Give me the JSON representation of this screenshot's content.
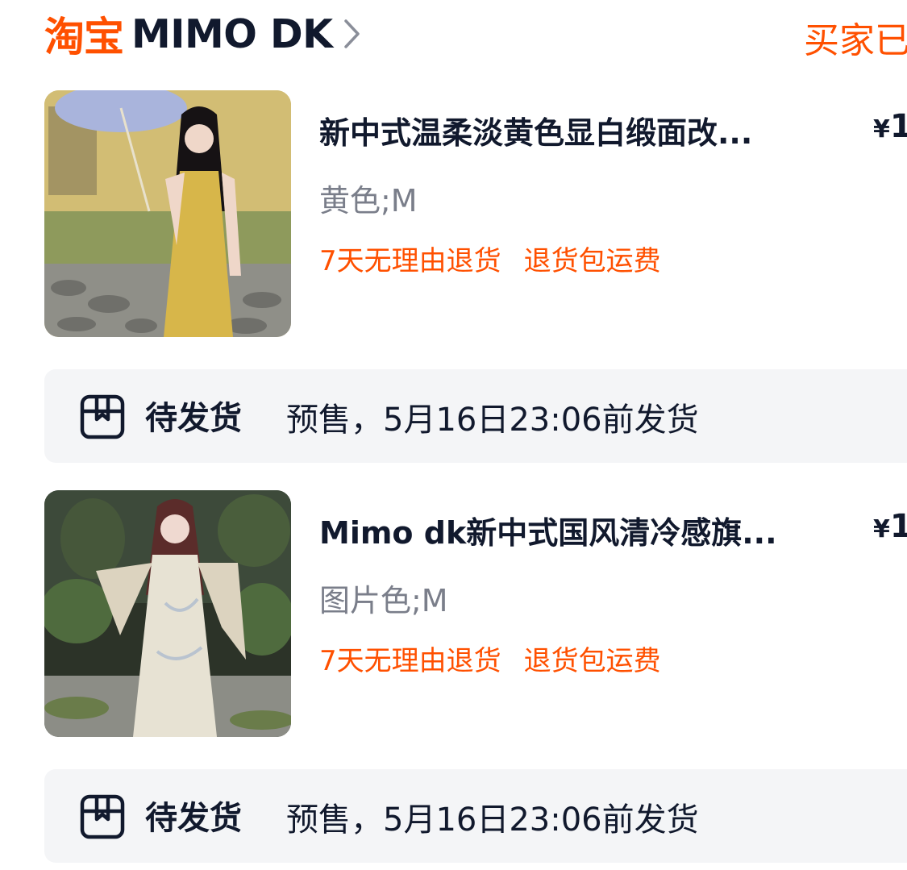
{
  "header": {
    "platform_logo": "淘宝",
    "shop_name": "MIMO DK",
    "status": "买家已"
  },
  "items": [
    {
      "title": "新中式温柔淡黄色显白缎面改...",
      "price_currency": "¥",
      "price_value": "1",
      "sku": "黄色;M",
      "tags": [
        "7天无理由退货",
        "退货包运费"
      ],
      "shipping": {
        "status": "待发货",
        "note": "预售，5月16日23:06前发货"
      }
    },
    {
      "title": "Mimo dk新中式国风清冷感旗...",
      "price_currency": "¥",
      "price_value": "1",
      "sku": "图片色;M",
      "tags": [
        "7天无理由退货",
        "退货包运费"
      ],
      "shipping": {
        "status": "待发货",
        "note": "预售，5月16日23:06前发货"
      }
    }
  ],
  "colors": {
    "accent": "#ff5000",
    "text_primary": "#11192d",
    "text_secondary": "#7a7e8a",
    "panel_bg": "#f4f5f7"
  },
  "icons": {
    "shop_chevron": "chevron-right-icon",
    "shipping": "package-box-icon"
  }
}
